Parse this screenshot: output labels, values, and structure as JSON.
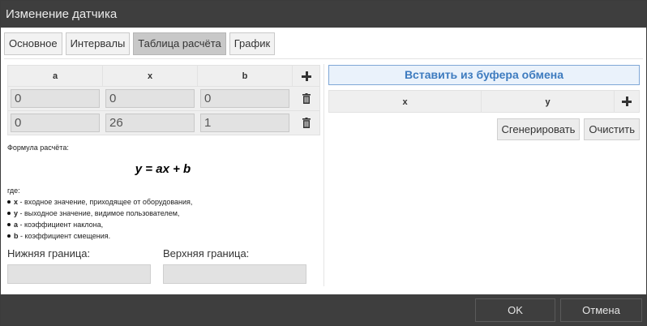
{
  "window": {
    "title": "Изменение датчика"
  },
  "tabs": [
    {
      "label": "Основное",
      "active": false
    },
    {
      "label": "Интервалы",
      "active": false
    },
    {
      "label": "Таблица расчёта",
      "active": true
    },
    {
      "label": "График",
      "active": false
    }
  ],
  "coef_table": {
    "headers": [
      "a",
      "x",
      "b"
    ],
    "rows": [
      [
        "0",
        "0",
        "0"
      ],
      [
        "0",
        "26",
        "1"
      ]
    ]
  },
  "formula": {
    "label": "Формула расчёта:",
    "expression": "y = ax + b",
    "where": "где:",
    "legend": [
      {
        "var": "x",
        "desc": " - входное значение, приходящее от оборудования,"
      },
      {
        "var": "y",
        "desc": " - выходное значение, видимое пользователем,"
      },
      {
        "var": "a",
        "desc": " - коэффициент наклона,"
      },
      {
        "var": "b",
        "desc": " - коэффициент смещения."
      }
    ]
  },
  "bounds": {
    "lower_label": "Нижняя граница:",
    "lower_value": "",
    "upper_label": "Верхняя граница:",
    "upper_value": ""
  },
  "right": {
    "paste_label": "Вставить из буфера обмена",
    "headers": [
      "x",
      "y"
    ],
    "generate_label": "Сгенерировать",
    "clear_label": "Очистить"
  },
  "footer": {
    "ok_label": "OK",
    "cancel_label": "Отмена"
  },
  "icons": {
    "add": "plus-icon",
    "delete": "trash-icon"
  },
  "colors": {
    "titlebar": "#3e3e3e",
    "accent": "#3d7bbf",
    "active_tab": "#c8c8c8"
  }
}
